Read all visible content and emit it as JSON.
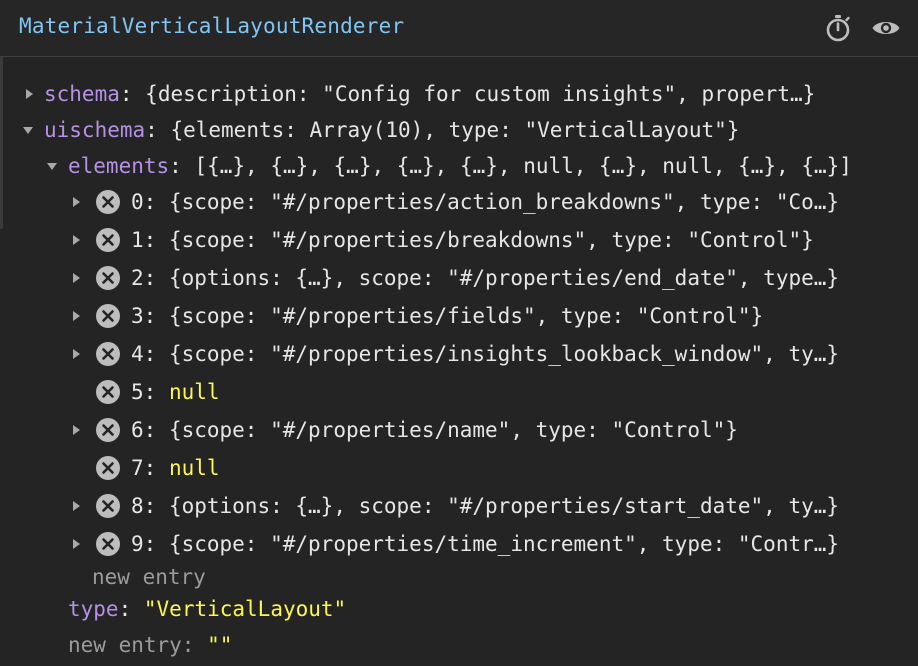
{
  "header": {
    "title": "MaterialVerticalLayoutRenderer",
    "timer_icon": "stopwatch-icon",
    "eye_icon": "eye-icon"
  },
  "tree": {
    "schema": {
      "key": "schema",
      "sep": ":",
      "value": "{description: \"Config for custom insights\", propert…}"
    },
    "uischema": {
      "key": "uischema",
      "sep": ":",
      "value": "{elements: Array(10), type: \"VerticalLayout\"}"
    },
    "elements": {
      "key": "elements",
      "sep": ":",
      "value": "[{…}, {…}, {…}, {…}, {…}, null, {…}, null, {…}, {…}]"
    },
    "items": [
      {
        "index": "0:",
        "value": "{scope: \"#/properties/action_breakdowns\", type: \"Co…}",
        "is_null": false
      },
      {
        "index": "1:",
        "value": "{scope: \"#/properties/breakdowns\", type: \"Control\"}",
        "is_null": false
      },
      {
        "index": "2:",
        "value": "{options: {…}, scope: \"#/properties/end_date\", type…}",
        "is_null": false
      },
      {
        "index": "3:",
        "value": "{scope: \"#/properties/fields\", type: \"Control\"}",
        "is_null": false
      },
      {
        "index": "4:",
        "value": "{scope: \"#/properties/insights_lookback_window\", ty…}",
        "is_null": false
      },
      {
        "index": "5:",
        "value": "null",
        "is_null": true
      },
      {
        "index": "6:",
        "value": "{scope: \"#/properties/name\", type: \"Control\"}",
        "is_null": false
      },
      {
        "index": "7:",
        "value": "null",
        "is_null": true
      },
      {
        "index": "8:",
        "value": "{options: {…}, scope: \"#/properties/start_date\", ty…}",
        "is_null": false
      },
      {
        "index": "9:",
        "value": "{scope: \"#/properties/time_increment\", type: \"Contr…}",
        "is_null": false
      }
    ],
    "elements_new_entry": "new entry",
    "type": {
      "key": "type",
      "sep": ":",
      "value": "\"VerticalLayout\""
    },
    "new_entry": {
      "key": "new entry",
      "sep": ":",
      "value": "\"\""
    }
  },
  "colors": {
    "background": "#242424",
    "title": "#7fc6f3",
    "key": "#b691e6",
    "string": "#fdf84b",
    "text": "#e6e6e6",
    "muted": "#9b9b9b"
  }
}
